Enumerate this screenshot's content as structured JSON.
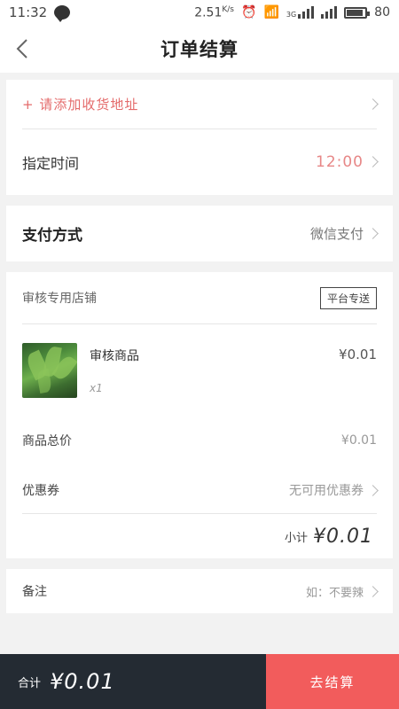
{
  "status_bar": {
    "time": "11:32",
    "speed": "2.51",
    "speed_unit": "K/s",
    "network": "3G",
    "battery": "80"
  },
  "header": {
    "title": "订单结算"
  },
  "address": {
    "add_label": "+ 请添加收货地址"
  },
  "delivery": {
    "label": "指定时间",
    "value": "12:00"
  },
  "payment": {
    "label": "支付方式",
    "value": "微信支付"
  },
  "shop": {
    "name": "审核专用店铺",
    "delivery_tag": "平台专送"
  },
  "item": {
    "name": "审核商品",
    "qty": "x1",
    "price": "¥0.01"
  },
  "summary": {
    "goods_total_label": "商品总价",
    "goods_total_value": "¥0.01",
    "coupon_label": "优惠券",
    "coupon_value": "无可用优惠券",
    "subtotal_label": "小计",
    "subtotal_value": "¥0.01"
  },
  "remark": {
    "label": "备注",
    "placeholder": "如：不要辣"
  },
  "footer": {
    "total_label": "合计",
    "total_value": "¥0.01",
    "checkout_label": "去结算"
  },
  "colors": {
    "accent": "#f25c5c",
    "footer_dark": "#242b33",
    "address_red": "#e46b6b",
    "time_red": "#e78787"
  }
}
